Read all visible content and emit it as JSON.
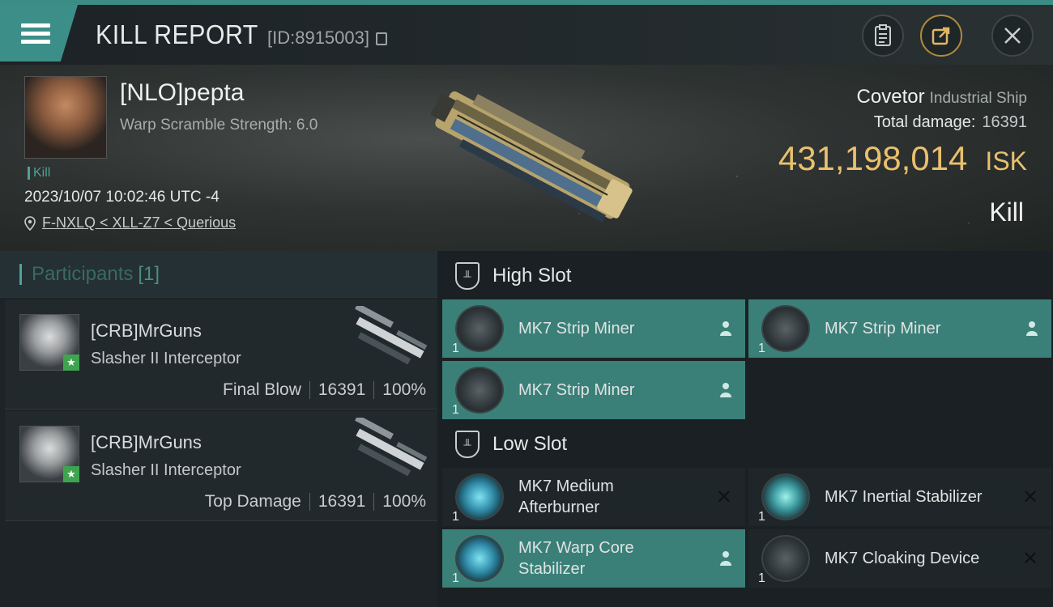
{
  "header": {
    "title": "KILL REPORT",
    "report_id": "[ID:8915003]",
    "icons": [
      "menu-icon",
      "copy-icon",
      "clipboard-icon",
      "share-icon",
      "close-icon"
    ]
  },
  "victim": {
    "name": "[NLO]pepta",
    "warp_scramble": "Warp Scramble Strength: 6.0",
    "tag": "Kill",
    "timestamp": "2023/10/07 10:02:46 UTC -4",
    "location": "F-NXLQ < XLL-Z7 < Querious",
    "ship_name": "Covetor",
    "ship_class": "Industrial Ship",
    "total_damage_label": "Total damage:",
    "total_damage_value": "16391",
    "isk_value": "431,198,014",
    "isk_unit": "ISK",
    "result": "Kill"
  },
  "participants": {
    "label": "Participants",
    "count": "[1]",
    "rows": [
      {
        "name": "[CRB]MrGuns",
        "ship": "Slasher II Interceptor",
        "role": "Final Blow",
        "damage": "16391",
        "percent": "100%"
      },
      {
        "name": "[CRB]MrGuns",
        "ship": "Slasher II Interceptor",
        "role": "Top Damage",
        "damage": "16391",
        "percent": "100%"
      }
    ]
  },
  "fitting": {
    "high_slot_label": "High Slot",
    "low_slot_label": "Low Slot",
    "high_slot": [
      {
        "name": "MK7 Strip Miner",
        "qty": "1",
        "state": "active"
      },
      {
        "name": "MK7 Strip Miner",
        "qty": "1",
        "state": "active"
      },
      {
        "name": "MK7 Strip Miner",
        "qty": "1",
        "state": "active"
      }
    ],
    "low_slot": [
      {
        "name": "MK7 Medium Afterburner",
        "qty": "1",
        "state": "destroyed"
      },
      {
        "name": "MK7 Inertial Stabilizer",
        "qty": "1",
        "state": "destroyed"
      },
      {
        "name": "MK7 Warp Core Stabilizer",
        "qty": "1",
        "state": "active"
      },
      {
        "name": "MK7 Cloaking Device",
        "qty": "1",
        "state": "destroyed"
      }
    ],
    "colors": {
      "active": "#3a8078",
      "inactive": "#1f2629",
      "accent": "#4fa29a",
      "isk": "#e9c06e"
    }
  }
}
